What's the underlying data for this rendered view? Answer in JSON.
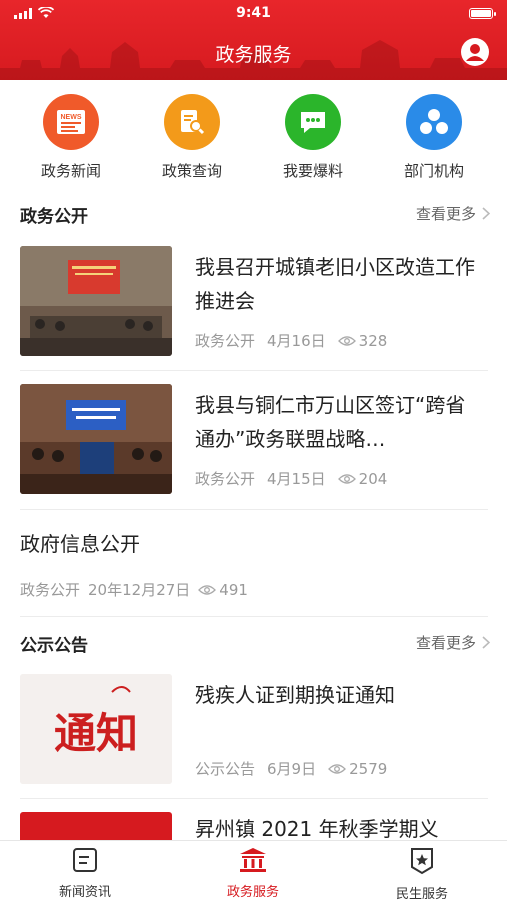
{
  "status_bar": {
    "time": "9:41"
  },
  "header": {
    "title": "政务服务"
  },
  "quick_entries": [
    {
      "label": "政务新闻",
      "icon": "news-icon",
      "color": "#f05a2a",
      "badge": "NEWS"
    },
    {
      "label": "政策查询",
      "icon": "policy-search-icon",
      "color": "#f39a1a"
    },
    {
      "label": "我要爆料",
      "icon": "chat-bubble-icon",
      "color": "#2bb52b"
    },
    {
      "label": "部门机构",
      "icon": "org-structure-icon",
      "color": "#2a8be8"
    }
  ],
  "section_open": {
    "title": "政务公开",
    "more": "查看更多",
    "items": [
      {
        "title": "我县召开城镇老旧小区改造工作推进会",
        "category": "政务公开",
        "date": "4月16日",
        "views": "328"
      },
      {
        "title": "我县与铜仁市万山区签订“跨省通办”政务联盟战略…",
        "category": "政务公开",
        "date": "4月15日",
        "views": "204"
      }
    ],
    "text_item": {
      "title": "政府信息公开",
      "category": "政务公开",
      "date": "20年12月27日",
      "views": "491"
    }
  },
  "section_notice": {
    "title": "公示公告",
    "more": "查看更多",
    "items": [
      {
        "title": "残疾人证到期换证通知",
        "category": "公示公告",
        "date": "6月9日",
        "views": "2579",
        "thumb_text": "通知"
      },
      {
        "title": "昇州镇 2021 年秋季学期义"
      }
    ]
  },
  "tabbar": [
    {
      "label": "新闻资讯",
      "icon": "news-tab-icon",
      "active": false
    },
    {
      "label": "政务服务",
      "icon": "government-building-icon",
      "active": true
    },
    {
      "label": "民生服务",
      "icon": "badge-star-icon",
      "active": false
    }
  ],
  "colors": {
    "primary": "#d61a1f",
    "text": "#222222",
    "meta": "#999999"
  }
}
